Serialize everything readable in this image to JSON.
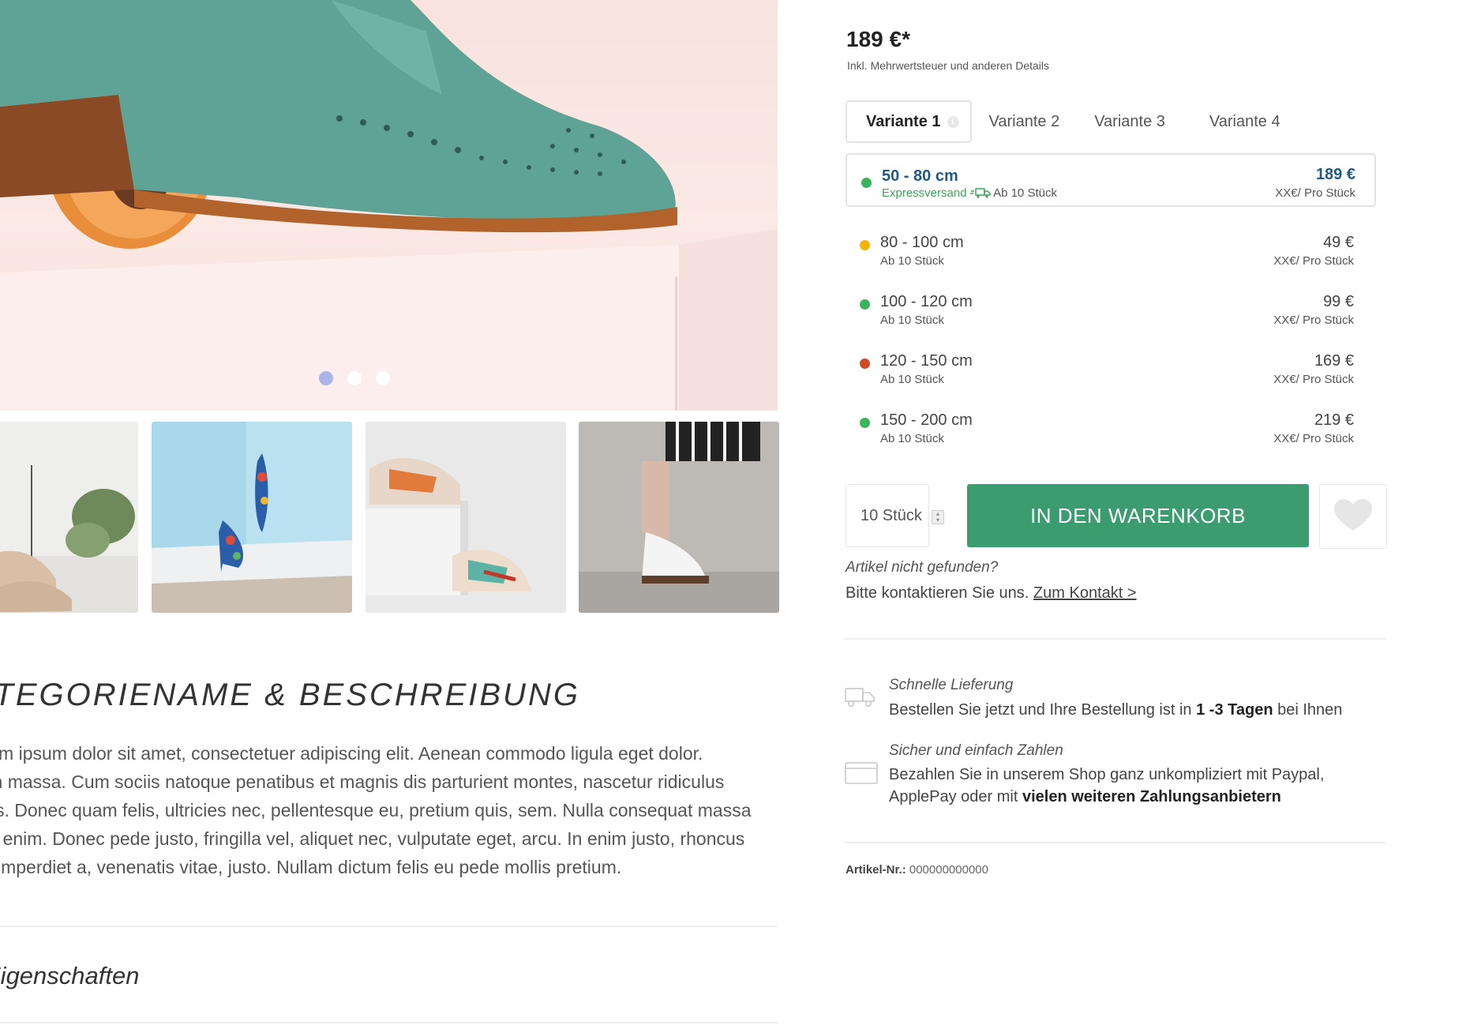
{
  "gallery": {
    "carousel_dots": [
      true,
      false,
      false
    ],
    "thumbnails": [
      "thumb-brogues-plant",
      "thumb-floral-heels",
      "thumb-sneakers",
      "thumb-platform-shoes"
    ]
  },
  "description": {
    "title": "KATEGORIENAME & BESCHREIBUNG",
    "lines": [
      "Lorem ipsum dolor sit amet, consectetuer adipiscing elit. Aenean commodo ligula eget dolor.",
      "Aenean massa. Cum sociis natoque penatibus et magnis dis parturient montes, nascetur ridiculus",
      "mus. Donec quam felis, ultricies nec, pellentesque eu, pretium quis, sem. Nulla consequat massa",
      "quis enim. Donec pede justo, fringilla vel, aliquet nec, vulputate eget, arcu. In enim justo, rhoncus",
      "ut, imperdiet a, venenatis vitae, justo. Nullam dictum felis eu pede mollis pretium."
    ],
    "properties_title": "Eigenschaften"
  },
  "product": {
    "price": "189 €*",
    "price_note": "Inkl. Mehrwertsteuer und anderen Details",
    "tabs": [
      "Variante 1",
      "Variante 2",
      "Variante 3",
      "Variante 4"
    ],
    "variants": [
      {
        "size": "50 - 80 cm",
        "express": "Expressversand",
        "min": "Ab 10 Stück",
        "price": "189 €",
        "unit": "XX€/ Pro Stück",
        "status_color": "#3ab55b"
      },
      {
        "size": "80 - 100 cm",
        "min": "Ab 10 Stück",
        "price": "49 €",
        "unit": "XX€/ Pro Stück",
        "status_color": "#f6b300"
      },
      {
        "size": "100 - 120 cm",
        "min": "Ab 10 Stück",
        "price": "99 €",
        "unit": "XX€/ Pro Stück",
        "status_color": "#3ab55b"
      },
      {
        "size": "120 - 150 cm",
        "min": "Ab 10 Stück",
        "price": "169 €",
        "unit": "XX€/ Pro Stück",
        "status_color": "#d24a24"
      },
      {
        "size": "150 - 200 cm",
        "min": "Ab 10 Stück",
        "price": "219 €",
        "unit": "XX€/ Pro Stück",
        "status_color": "#3ab55b"
      }
    ],
    "quantity": "10 Stück",
    "cart_button": "IN DEN WARENKORB",
    "not_found": "Artikel nicht gefunden?",
    "contact_text": "Bitte kontaktieren Sie uns.",
    "contact_link": "Zum Kontakt >",
    "features": [
      {
        "icon": "truck-icon",
        "title": "Schnelle Lieferung",
        "text_pre": "Bestellen Sie jetzt und Ihre Bestellung ist in ",
        "text_bold": "1 -3 Tagen",
        "text_post": " bei Ihnen"
      },
      {
        "icon": "credit-card-icon",
        "title": "Sicher und einfach Zahlen",
        "text_line1": "Bezahlen Sie in unserem Shop ganz unkompliziert mit Paypal,",
        "text_line2_pre": "ApplePay oder mit ",
        "text_line2_bold": "vielen weiteren Zahlungsanbietern"
      }
    ],
    "article_label": "Artikel-Nr.:",
    "article_number": "000000000000"
  },
  "colors": {
    "accent_green": "#3a9c6f",
    "selected_blue": "#1f5a84",
    "express_green": "#3aa55b"
  }
}
